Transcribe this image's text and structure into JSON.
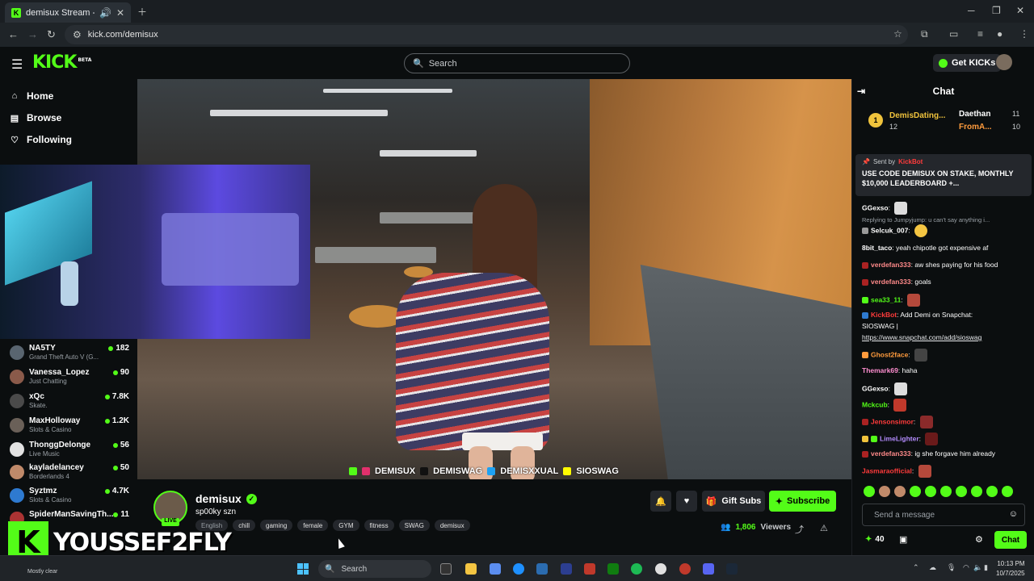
{
  "browser": {
    "tab_title": "demisux Stream - Watch Live",
    "url": "kick.com/demisux"
  },
  "header": {
    "logo": "KICK",
    "logo_badge": "BETA",
    "search_placeholder": "Search",
    "get_kicks": "Get KICKs"
  },
  "sidebar": {
    "nav": [
      {
        "label": "Home",
        "icon": "home-icon"
      },
      {
        "label": "Browse",
        "icon": "browse-icon"
      },
      {
        "label": "Following",
        "icon": "heart-icon"
      }
    ],
    "channels": [
      {
        "name": "NA5TY",
        "category": "Grand Theft Auto V (G...",
        "viewers": "182"
      },
      {
        "name": "Vanessa_Lopez",
        "category": "Just Chatting",
        "viewers": "90"
      },
      {
        "name": "xQc",
        "category": "Skate.",
        "viewers": "7.8K"
      },
      {
        "name": "MaxHolloway",
        "category": "Slots & Casino",
        "viewers": "1.2K"
      },
      {
        "name": "ThonggDelonge",
        "category": "Live Music",
        "viewers": "56"
      },
      {
        "name": "kayladelancey",
        "category": "Borderlands 4",
        "viewers": "50"
      },
      {
        "name": "Syztmz",
        "category": "Slots & Casino",
        "viewers": "4.7K"
      },
      {
        "name": "SpiderManSavingTh...",
        "category": "",
        "viewers": "11"
      }
    ]
  },
  "video": {
    "overlay_socials": [
      "DEMISUX",
      "DEMISWAG",
      "DEMISXXUAL",
      "SIOSWAG"
    ],
    "banner_text": "YOUSSEF2FLY"
  },
  "stream": {
    "streamer": "demisux",
    "live_label": "LIVE",
    "title": "sp00ky szn",
    "language": "English",
    "tags": [
      "chill",
      "gaming",
      "female",
      "GYM",
      "fitness",
      "SWAG",
      "demisux"
    ],
    "gift_subs": "Gift Subs",
    "subscribe": "Subscribe",
    "viewers": "1,806",
    "viewers_label": "Viewers"
  },
  "chat": {
    "title": "Chat",
    "leaderboard": [
      {
        "rank": "1",
        "name": "DemisDating...",
        "count": "12"
      },
      {
        "name": "Daethan",
        "count": "11"
      },
      {
        "name": "FromA...",
        "count": "10"
      }
    ],
    "pinned": {
      "sent_by_label": "Sent by",
      "sender": "KickBot",
      "text": "USE CODE DEMISUX ON STAKE, MONTHLY $10,000 LEADERBOARD +..."
    },
    "messages": [
      {
        "user": "GGexso",
        "text": "",
        "color": "#ffffff"
      },
      {
        "reply": "Replying to Jumpyjump: u can't say anything i..."
      },
      {
        "user": "Selcuk_007",
        "text": "",
        "color": "#ffffff"
      },
      {
        "user": "8bit_taco",
        "text": "yeah chipotle got expensive af",
        "color": "#ffffff"
      },
      {
        "user": "verdefan333",
        "text": "aw shes paying for his food",
        "color": "#ff8a8a"
      },
      {
        "user": "verdefan333",
        "text": "goals",
        "color": "#ff8a8a"
      },
      {
        "user": "sea33_11",
        "text": "",
        "color": "#53fc18"
      },
      {
        "user": "KickBot",
        "text": "Add Demi on Snapchat:",
        "color": "#ff3b3b"
      },
      {
        "user": "",
        "text": "SIOSWAG |",
        "color": "#ffffff"
      },
      {
        "user": "",
        "text": "https://www.snapchat.com/add/sioswag",
        "color": "#ffffff"
      },
      {
        "user": "Ghost2face",
        "text": "",
        "color": "#ff9b3d"
      },
      {
        "user": "Themark69",
        "text": "haha",
        "color": "#ff8fd0"
      },
      {
        "user": "GGexso",
        "text": "",
        "color": "#ffffff"
      },
      {
        "user": "Mckcub",
        "text": "",
        "color": "#53fc18"
      },
      {
        "user": "Jensonsimor",
        "text": "",
        "color": "#ff3b3b"
      },
      {
        "user": "LimeLighter",
        "text": "",
        "color": "#b48cff"
      },
      {
        "user": "verdefan333",
        "text": "ig she forgave him already",
        "color": "#ff8a8a"
      },
      {
        "user": "Jasmaraofficial",
        "text": "",
        "color": "#ff3b3b"
      }
    ],
    "input_placeholder": "Send a message",
    "kicks": "40",
    "send": "Chat"
  },
  "taskbar": {
    "weather": "Mostly clear",
    "search": "Search",
    "time": "10:13 PM",
    "date": "10/7/2025"
  },
  "colors": {
    "accent": "#53fc18",
    "background": "#0b0e0f"
  }
}
